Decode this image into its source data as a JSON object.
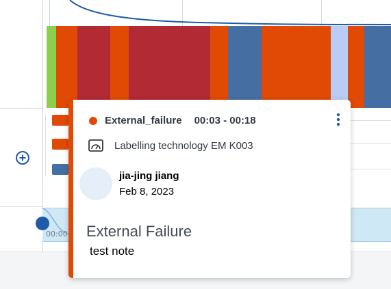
{
  "colors": {
    "external_failure": "#e04a05",
    "dark_red": "#b22a33",
    "steel_blue": "#456ea2",
    "light_blue": "#b9ccf6",
    "green": "#8ccf4d",
    "accent_blue": "#1e5aa8"
  },
  "timeline": {
    "segments": [
      {
        "color": "#8ccf4d"
      },
      {
        "color": "#e04a05"
      },
      {
        "color": "#b22a33"
      },
      {
        "color": "#e04a05"
      },
      {
        "color": "#b22a33"
      },
      {
        "color": "#e04a05"
      },
      {
        "color": "#456ea2"
      },
      {
        "color": "#e04a05"
      },
      {
        "color": "#b9ccf6"
      },
      {
        "color": "#e04a05"
      },
      {
        "color": "#456ea2"
      }
    ],
    "mini_bars": [
      {
        "color": "#e04a05"
      },
      {
        "color": "#e04a05"
      },
      {
        "color": "#456ea2"
      }
    ],
    "time_label": "00:00"
  },
  "popover": {
    "status_name": "External_failure",
    "time_range": "00:03 - 00:18",
    "machine_icon": "gauge-icon",
    "machine_name": "Labelling technology EM K003",
    "user_name": "jia-jing jiang",
    "date": "Feb 8, 2023",
    "reason_title": "External Failure",
    "note": "test note"
  },
  "icons": {
    "add": "plus-circle-icon",
    "menu": "kebab-menu-icon"
  }
}
